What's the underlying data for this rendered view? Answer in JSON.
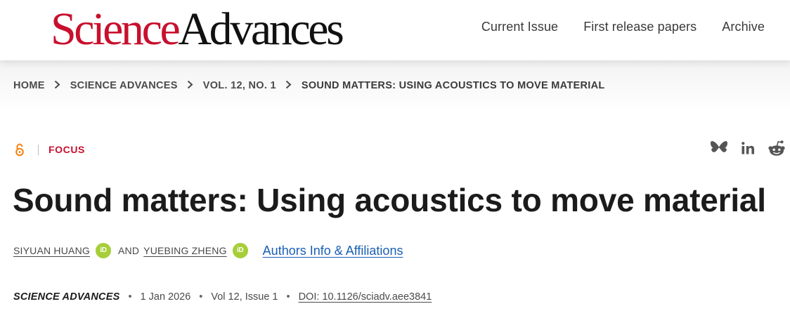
{
  "header": {
    "logo": {
      "science": "Science",
      "advances": "Advances"
    },
    "nav": [
      {
        "label": "Current Issue"
      },
      {
        "label": "First release papers"
      },
      {
        "label": "Archive"
      }
    ]
  },
  "breadcrumb": {
    "items": [
      "HOME",
      "SCIENCE ADVANCES",
      "VOL. 12, NO. 1",
      "SOUND MATTERS: USING ACOUSTICS TO MOVE MATERIAL"
    ],
    "separator_icon": "chevron-right-icon"
  },
  "article": {
    "access_icon": "open-access-icon",
    "type": "FOCUS",
    "title": "Sound matters: Using acoustics to move material",
    "authors": [
      {
        "name": "SIYUAN HUANG",
        "orcid_label": "iD"
      },
      {
        "name": "YUEBING ZHENG",
        "orcid_label": "iD"
      }
    ],
    "and_text": "AND",
    "authors_info_link": "Authors Info & Affiliations",
    "journal": "SCIENCE ADVANCES",
    "date": "1 Jan 2026",
    "volume_issue": "Vol 12, Issue 1",
    "doi": "DOI: 10.1126/sciadv.aee3841",
    "meta_separator": "•"
  },
  "share": {
    "icons": [
      "bluesky-icon",
      "linkedin-icon",
      "reddit-icon"
    ]
  },
  "colors": {
    "brand_red": "#c8102e",
    "link_blue": "#1a5fb4",
    "orcid_green": "#a6ce39",
    "open_access_orange": "#f68212"
  }
}
